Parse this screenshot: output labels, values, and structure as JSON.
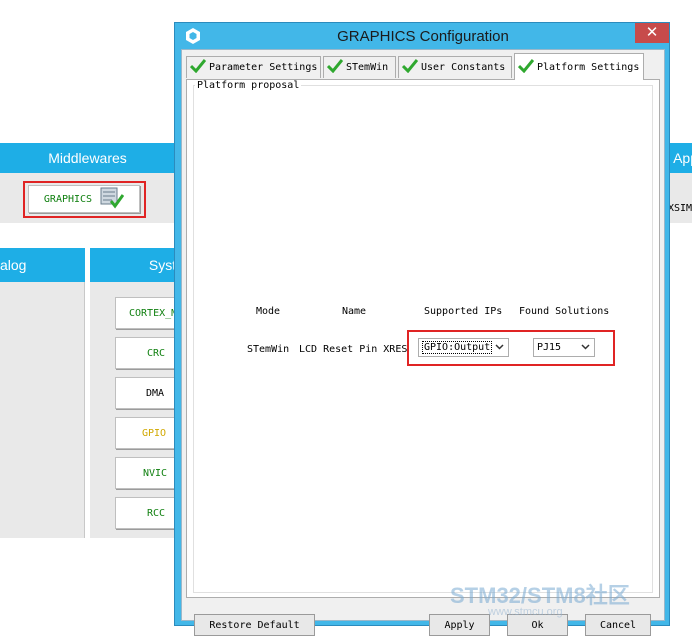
{
  "background": {
    "middlewares_label": "Middlewares",
    "graphics_button_label": "GRAPHICS",
    "app_header_partial": "App",
    "xsim_partial": "XSIM",
    "analog_header_partial": "alog",
    "system_header_partial": "Syst",
    "peripherals": [
      {
        "label": "CORTEX_M",
        "color": "#108010"
      },
      {
        "label": "CRC",
        "color": "#108010"
      },
      {
        "label": "DMA",
        "color": "#000000"
      },
      {
        "label": "GPIO",
        "color": "#d1a800"
      },
      {
        "label": "NVIC",
        "color": "#108010"
      },
      {
        "label": "RCC",
        "color": "#108010"
      }
    ]
  },
  "dialog": {
    "title": "GRAPHICS Configuration",
    "close_label": "✕",
    "tabs": [
      {
        "label": "Parameter Settings"
      },
      {
        "label": "STemWin"
      },
      {
        "label": "User Constants"
      },
      {
        "label": "Platform Settings"
      }
    ],
    "group_title": "Platform proposal",
    "table": {
      "headers": {
        "mode": "Mode",
        "name": "Name",
        "supported_ips": "Supported IPs",
        "found_solutions": "Found Solutions"
      },
      "row": {
        "mode": "STemWin",
        "name": "LCD Reset Pin XRES",
        "supported_ip": "GPIO:Output",
        "found_solution": "PJ15"
      }
    },
    "buttons": {
      "restore_default": "Restore Default",
      "apply": "Apply",
      "ok": "Ok",
      "cancel": "Cancel"
    }
  },
  "watermark": {
    "text": "STM32/STM8社区",
    "url": "www.stmcu.org"
  },
  "colors": {
    "accent_blue": "#1eaee6",
    "title_bar": "#42b7e8",
    "close_red": "#c74b4b",
    "highlight_red": "#e02424",
    "check_green": "#2fa82f"
  }
}
